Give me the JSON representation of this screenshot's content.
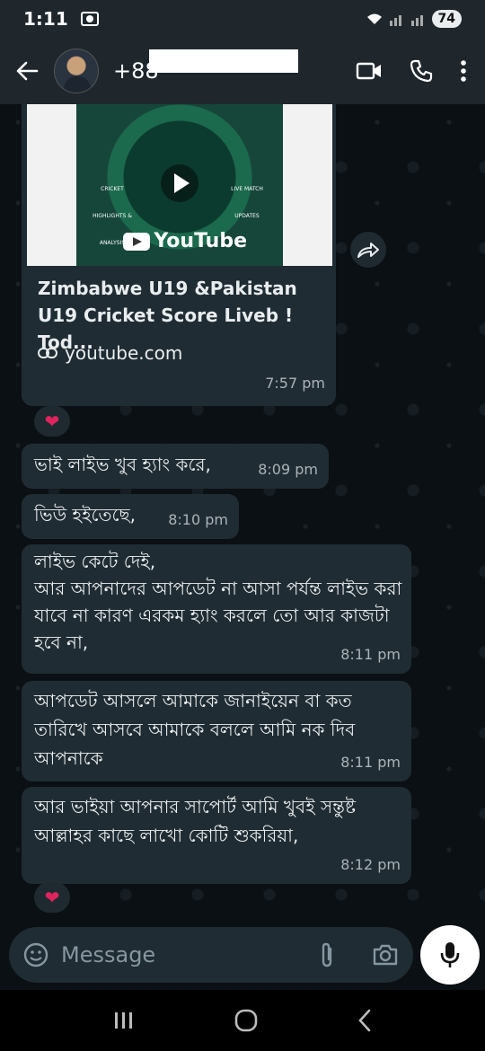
{
  "status_bar": {
    "time": "1:11",
    "battery": "74"
  },
  "header": {
    "contact_name": "+88"
  },
  "link_preview": {
    "thumb_left_text": "CRICKET HIGHLIGHTS & ANALYSIS",
    "thumb_right_text": "LIVE MATCH UPDATES",
    "thumb_brand": "YouTube",
    "title": "Zimbabwe U19 &Pakistan U19 Cricket Score Liveb ! Tod...",
    "domain": "youtube.com",
    "time": "7:57 pm"
  },
  "messages": [
    {
      "text": "ভাই লাইভ খুব হ্যাং করে,",
      "time": "8:09 pm"
    },
    {
      "text": "ভিউ হইতেছে,",
      "time": "8:10 pm"
    },
    {
      "text": "লাইভ কেটে দেই,\nআর আপনাদের আপডেট না আসা পর্যন্ত লাইভ করা যাবে না কারণ এরকম হ্যাং করলে তো আর কাজটা হবে না,",
      "time": "8:11 pm"
    },
    {
      "text": "আপডেট আসলে আমাকে জানাইয়েন বা কত তারিখে আসবে আমাকে বললে আমি নক দিব আপনাকে",
      "time": "8:11 pm"
    },
    {
      "text": "আর ভাইয়া আপনার সাপোর্ট আমি খুবই সন্তুষ্ট আল্লাহর কাছে লাখো কোটি শুকরিয়া,",
      "time": "8:12 pm"
    }
  ],
  "input": {
    "placeholder": "Message"
  },
  "colors": {
    "bubble": "#202c33",
    "background": "#0b1014",
    "header": "#1f272d",
    "reaction_heart": "#e0245e"
  },
  "icons": [
    "back-arrow-icon",
    "video-call-icon",
    "voice-call-icon",
    "more-options-icon",
    "forward-icon",
    "link-icon",
    "emoji-icon",
    "attach-icon",
    "camera-icon",
    "mic-icon",
    "heart-icon",
    "recents-icon",
    "home-icon",
    "nav-back-icon"
  ]
}
